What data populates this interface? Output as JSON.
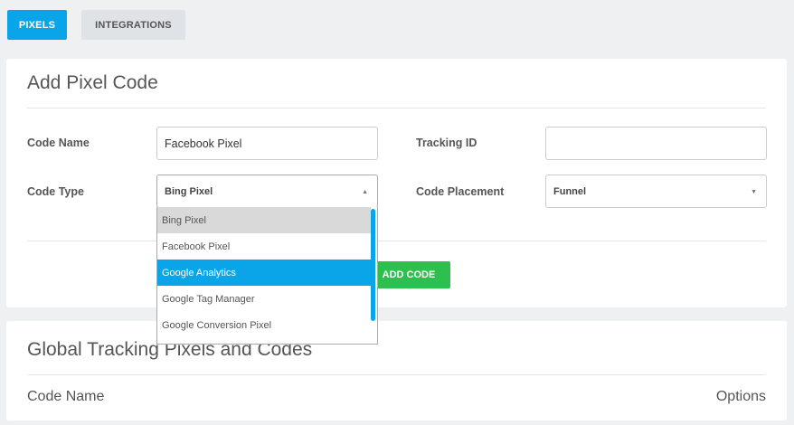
{
  "tabs": [
    {
      "label": "PIXELS",
      "active": true
    },
    {
      "label": "INTEGRATIONS",
      "active": false
    }
  ],
  "add_pixel": {
    "title": "Add Pixel Code",
    "code_name_label": "Code Name",
    "code_name_value": "Facebook Pixel",
    "tracking_id_label": "Tracking ID",
    "tracking_id_value": "",
    "code_type_label": "Code Type",
    "code_type_value": "Bing Pixel",
    "code_placement_label": "Code Placement",
    "code_placement_value": "Funnel",
    "code_type_options": [
      "Bing Pixel",
      "Facebook Pixel",
      "Google Analytics",
      "Google Tag Manager",
      "Google Conversion Pixel"
    ],
    "add_button_label": "ADD CODE"
  },
  "global": {
    "title": "Global Tracking Pixels and Codes",
    "columns": [
      "Code Name",
      "Options"
    ]
  },
  "colors": {
    "accent": "#0aa5e9",
    "success": "#2dc04f",
    "background": "#eef0f2"
  }
}
